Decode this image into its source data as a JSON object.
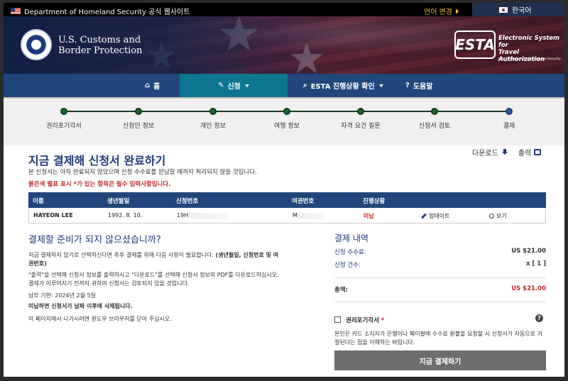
{
  "topbar": {
    "gov_label": "Department of Homeland Security 공식 웹사이트",
    "lang_change": "언어 변경",
    "current_lang": "한국어"
  },
  "header": {
    "agency_line1": "U.S. Customs and",
    "agency_line2": "Border Protection",
    "esta_mark": "ESTA",
    "esta_line1": "Electronic System for",
    "esta_line2": "Travel Authorization",
    "esta_sub": "U.S. Department of Homeland Security"
  },
  "nav": {
    "home": "홈",
    "apply": "신청",
    "status": "ESTA 진행상황 확인",
    "help": "도움말"
  },
  "progress": {
    "steps": [
      "권리포기각서",
      "신청인 정보",
      "개인 정보",
      "여행 정보",
      "자격 요건 질문",
      "신청서 검토",
      "결제"
    ],
    "current_index": 6
  },
  "main": {
    "title": "지금 결제해 신청서 완료하기",
    "download": "다운로드",
    "print": "출력",
    "note": "본 신청서는 아직 완료되지 않았으며 신청 수수료를 완납할 때까지 처리되지 않을 것입니다.",
    "required_note": "붉은색 별표 표시 *가 있는 항목은 필수 입력사항입니다."
  },
  "table": {
    "headers": [
      "이름",
      "생년월일",
      "신청번호",
      "여권번호",
      "진행상황"
    ],
    "row": {
      "name": "HAYEON LEE",
      "dob": "1992. 8. 10.",
      "app_no": "19H",
      "passport": "M",
      "status": "미납",
      "update": "업데이트",
      "view": "보기"
    }
  },
  "left": {
    "heading": "결제할 준비가 되지 않으셨습니까?",
    "p1_a": "지금 결제하지 않기로 선택하신다면 추후 결제를 위해 다음 사항이 필요합니다. ",
    "p1_b": "(생년월일, 신청번호 및 여권번호)",
    "p2": "\"출력\"을 선택해 신청서 정보를 출력하시고 \"다운로드\"를 선택해 신청서 정보의 PDF를 다운로드하십시오. 결제가 이루어지기 전까지 귀하의 신청서는 검토되지 않을 것입니다.",
    "due_label": "납부 기한: ",
    "due_date": "2024년 2월 5일",
    "p3": "미납하면 신청서가 날짜 이후에 삭제됩니다.",
    "p4": "이 페이지에서 나가시려면 윈도우 브라우저를 닫아 주십시오."
  },
  "right": {
    "heading": "결제 내역",
    "fee_label": "신청 수수료:",
    "fee_value": "US $21.00",
    "count_label": "신청 건수:",
    "count_value": "x [ 1 ]",
    "total_label": "총액:",
    "total_value": "US $21.00",
    "waiver_label": "권리포기각서",
    "waiver_star": "*",
    "help_glyph": "?",
    "disclaimer": "본인은 카드 소지자가 은행이나 페이팔에 수수료 환불을 요청할 시 신청서가 자동으로 거절된다는 점을 이해하는 바입니다.",
    "pay_button": "지금 결제하기"
  }
}
